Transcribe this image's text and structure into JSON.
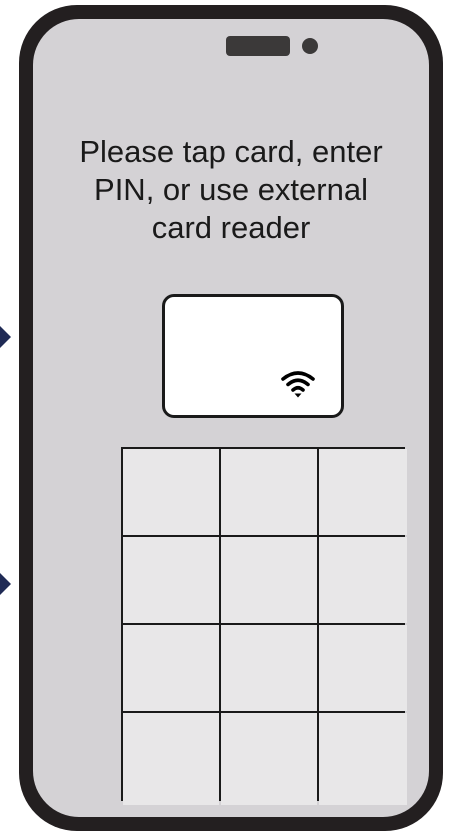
{
  "prompt": {
    "text": "Please tap card, enter\nPIN, or use external\ncard reader"
  },
  "card_reader": {
    "icon": "contactless-icon"
  },
  "keypad": {
    "rows": 4,
    "columns": 3
  },
  "colors": {
    "phone_frame": "#231f20",
    "screen": "#d4d2d5",
    "key": "#e8e7e8",
    "arrow": "#1f2a55"
  }
}
